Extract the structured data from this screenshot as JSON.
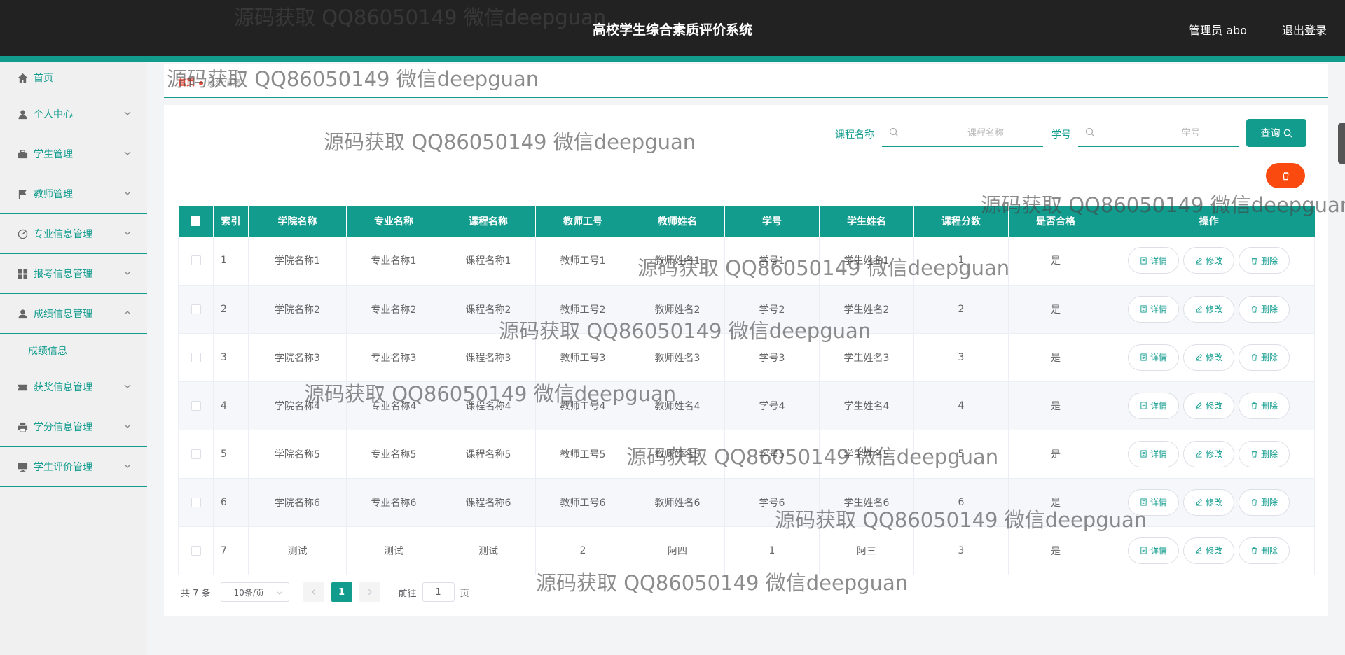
{
  "header": {
    "title": "高校学生综合素质评价系统",
    "user": "管理员 abo",
    "logout": "退出登录"
  },
  "sidebar": {
    "items": [
      {
        "label": "首页",
        "icon": "home-icon"
      },
      {
        "label": "个人中心",
        "icon": "user-icon"
      },
      {
        "label": "学生管理",
        "icon": "briefcase-icon"
      },
      {
        "label": "教师管理",
        "icon": "flag-icon"
      },
      {
        "label": "专业信息管理",
        "icon": "dashboard-icon"
      },
      {
        "label": "报考信息管理",
        "icon": "grid-icon"
      },
      {
        "label": "成绩信息管理",
        "icon": "user-icon"
      },
      {
        "label": "获奖信息管理",
        "icon": "ticket-icon"
      },
      {
        "label": "学分信息管理",
        "icon": "printer-icon"
      },
      {
        "label": "学生评价管理",
        "icon": "monitor-icon"
      }
    ],
    "submenu": "成绩信息"
  },
  "breadcrumb": {
    "home": "首页",
    "current": "成绩信息"
  },
  "search": {
    "course_label": "课程名称",
    "course_placeholder": "课程名称",
    "student_label": "学号",
    "student_placeholder": "学号",
    "query_label": "查询"
  },
  "table": {
    "headers": [
      "索引",
      "学院名称",
      "专业名称",
      "课程名称",
      "教师工号",
      "教师姓名",
      "学号",
      "学生姓名",
      "课程分数",
      "是否合格",
      "操作"
    ],
    "rows": [
      [
        "1",
        "学院名称1",
        "专业名称1",
        "课程名称1",
        "教师工号1",
        "教师姓名1",
        "学号1",
        "学生姓名1",
        "1",
        "是"
      ],
      [
        "2",
        "学院名称2",
        "专业名称2",
        "课程名称2",
        "教师工号2",
        "教师姓名2",
        "学号2",
        "学生姓名2",
        "2",
        "是"
      ],
      [
        "3",
        "学院名称3",
        "专业名称3",
        "课程名称3",
        "教师工号3",
        "教师姓名3",
        "学号3",
        "学生姓名3",
        "3",
        "是"
      ],
      [
        "4",
        "学院名称4",
        "专业名称4",
        "课程名称4",
        "教师工号4",
        "教师姓名4",
        "学号4",
        "学生姓名4",
        "4",
        "是"
      ],
      [
        "5",
        "学院名称5",
        "专业名称5",
        "课程名称5",
        "教师工号5",
        "教师姓名5",
        "学号5",
        "学生姓名5",
        "5",
        "是"
      ],
      [
        "6",
        "学院名称6",
        "专业名称6",
        "课程名称6",
        "教师工号6",
        "教师姓名6",
        "学号6",
        "学生姓名6",
        "6",
        "是"
      ],
      [
        "7",
        "测试",
        "测试",
        "测试",
        "2",
        "阿四",
        "1",
        "阿三",
        "3",
        "是"
      ]
    ],
    "actions": [
      "详情",
      "修改",
      "删除"
    ]
  },
  "pagination": {
    "total": "共 7 条",
    "page_size": "10条/页",
    "current_page": "1",
    "goto_label": "前往",
    "goto_value": "1",
    "goto_suffix": "页"
  },
  "watermark": "源码获取 QQ86050149 微信deepguan",
  "colors": {
    "accent": "#119c8e",
    "header_bg": "#222222",
    "danger": "#fb4a0f"
  }
}
